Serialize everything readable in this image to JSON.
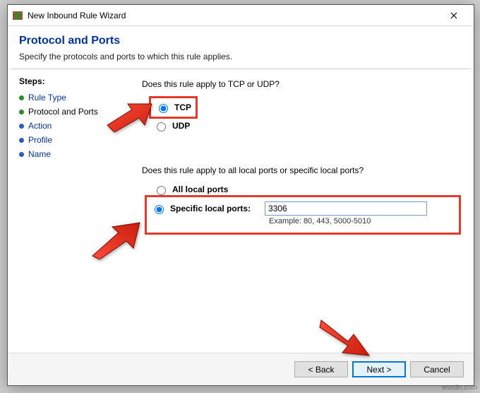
{
  "window": {
    "title": "New Inbound Rule Wizard"
  },
  "header": {
    "heading": "Protocol and Ports",
    "subtitle": "Specify the protocols and ports to which this rule applies."
  },
  "steps": {
    "label": "Steps:",
    "items": [
      {
        "label": "Rule Type"
      },
      {
        "label": "Protocol and Ports"
      },
      {
        "label": "Action"
      },
      {
        "label": "Profile"
      },
      {
        "label": "Name"
      }
    ],
    "current_index": 1
  },
  "protocol": {
    "question": "Does this rule apply to TCP or UDP?",
    "tcp_label": "TCP",
    "udp_label": "UDP",
    "selected": "tcp"
  },
  "ports": {
    "question": "Does this rule apply to all local ports or specific local ports?",
    "all_label": "All local ports",
    "specific_label": "Specific local ports:",
    "value": "3306",
    "example": "Example: 80, 443, 5000-5010",
    "selected": "specific"
  },
  "buttons": {
    "back": "< Back",
    "next": "Next >",
    "cancel": "Cancel"
  },
  "watermark": "wsxdn.com"
}
